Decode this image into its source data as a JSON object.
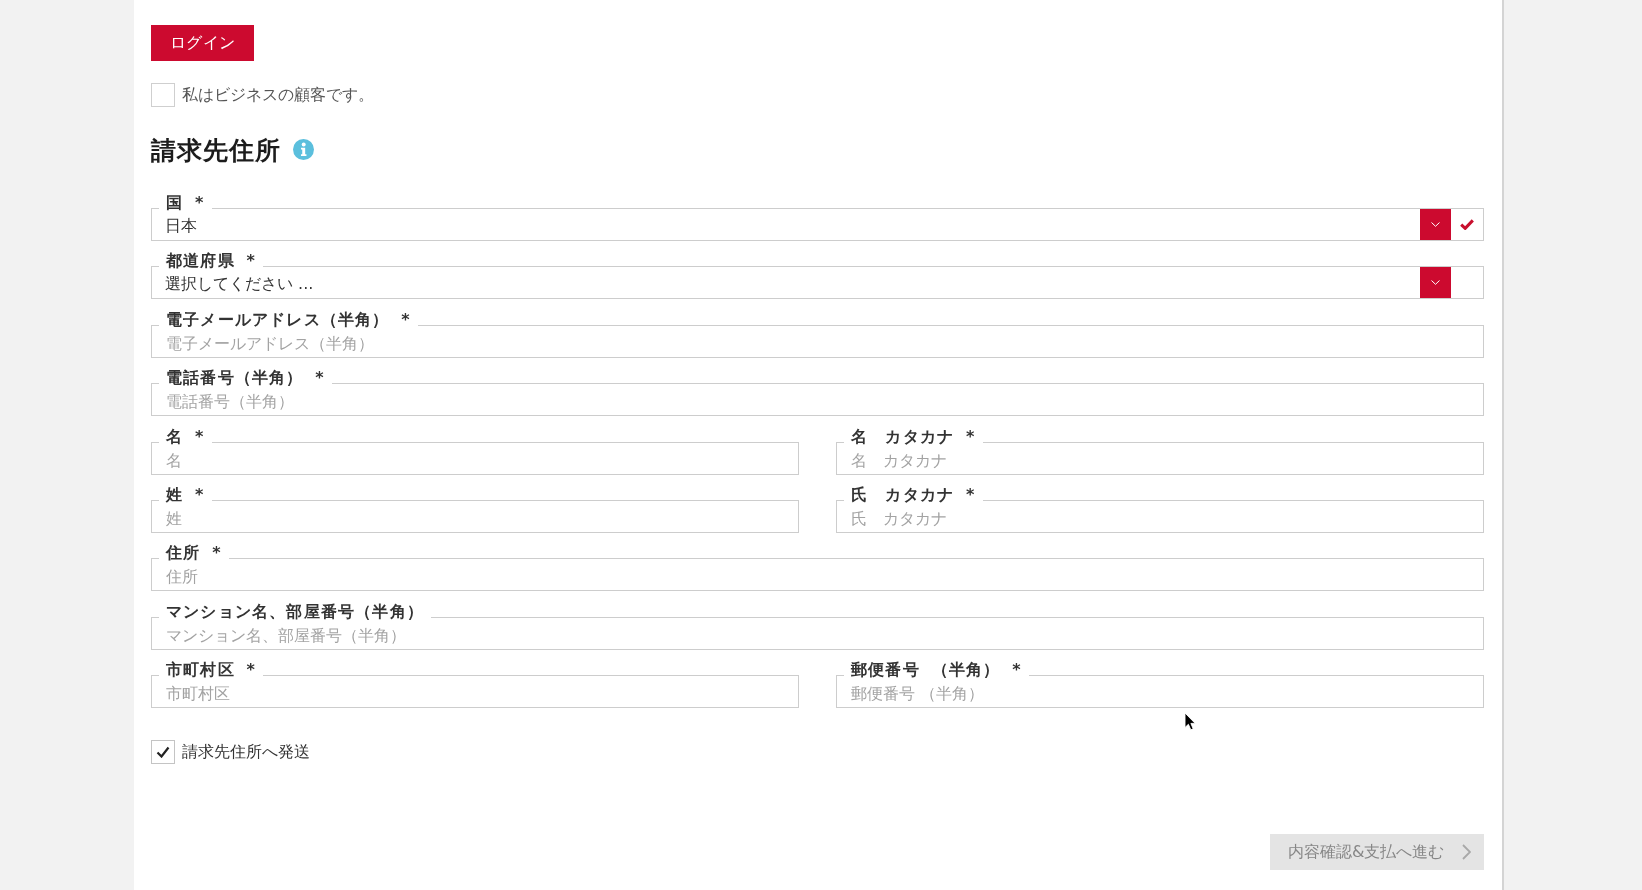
{
  "login_button": {
    "label": "ログイン"
  },
  "business_customer": {
    "label": "私はビジネスの顧客です。",
    "checked": false
  },
  "billing_address": {
    "title": "請求先住所",
    "rows": [
      [
        {
          "kind": "select",
          "label": "国 *",
          "value": "日本",
          "valid": true
        }
      ],
      [
        {
          "kind": "select",
          "label": "都道府県 *",
          "value": "選択してください ...",
          "valid": false
        }
      ],
      [
        {
          "kind": "text",
          "label": "電子メールアドレス（半角） *",
          "placeholder": "電子メールアドレス（半角）"
        }
      ],
      [
        {
          "kind": "text",
          "label": "電話番号（半角） *",
          "placeholder": "電話番号（半角）"
        }
      ],
      [
        {
          "kind": "text",
          "label": "名 *",
          "placeholder": "名"
        },
        {
          "kind": "text",
          "label": "名　カタカナ *",
          "placeholder": "名　カタカナ"
        }
      ],
      [
        {
          "kind": "text",
          "label": "姓 *",
          "placeholder": "姓"
        },
        {
          "kind": "text",
          "label": "氏　カタカナ *",
          "placeholder": "氏　カタカナ"
        }
      ],
      [
        {
          "kind": "text",
          "label": "住所 *",
          "placeholder": "住所"
        }
      ],
      [
        {
          "kind": "text",
          "label": "マンション名、部屋番号（半角）",
          "placeholder": "マンション名、部屋番号（半角）"
        }
      ],
      [
        {
          "kind": "text",
          "label": "市町村区 *",
          "placeholder": "市町村区"
        },
        {
          "kind": "text",
          "label": "郵便番号 （半角） *",
          "placeholder": "郵便番号 （半角）"
        }
      ]
    ]
  },
  "ship_to_billing": {
    "label": "請求先住所へ発送",
    "checked": true
  },
  "continue_button": {
    "label": "内容確認&支払へ進む",
    "disabled": true
  }
}
